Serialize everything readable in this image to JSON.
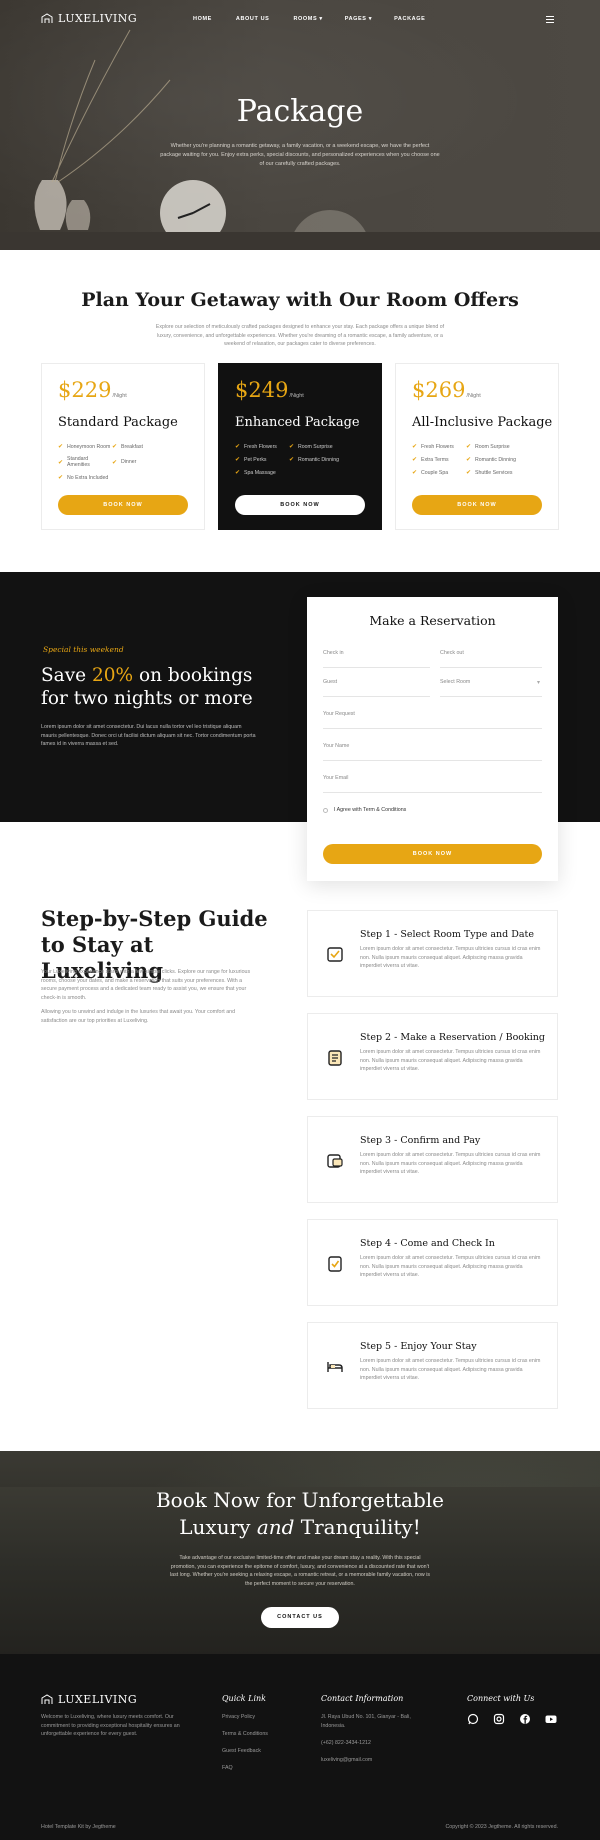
{
  "brand": {
    "name": "LUXELIVING",
    "logo_icon": "house-logo-icon"
  },
  "nav": {
    "items": [
      "HOME",
      "ABOUT US",
      "ROOMS ▾",
      "PAGES ▾",
      "PACKAGE"
    ],
    "menu_icon": "hamburger-menu-icon"
  },
  "hero": {
    "title": "Package",
    "text": "Whether you're planning a romantic getaway, a family vacation, or a weekend escape, we have the perfect package waiting for you. Enjoy extra perks, special discounts, and personalized experiences when you choose one of our carefully crafted packages."
  },
  "offers": {
    "title": "Plan Your Getaway with Our Room Offers",
    "text": "Explore our selection of meticulously crafted packages designed to enhance your stay. Each package offers a unique blend of luxury, convenience, and unforgettable experiences. Whether you're dreaming of a romantic escape, a family adventure, or a weekend of relaxation, our packages cater to diverse preferences.",
    "cards": [
      {
        "price": "$229",
        "unit": "/Night",
        "name": "Standard Package",
        "features": [
          "Honeymoon Room",
          "Breakfast",
          "Standard Amenities",
          "Dinner",
          "No Extra Included"
        ],
        "button": "BOOK NOW"
      },
      {
        "price": "$249",
        "unit": "/Night",
        "name": "Enhanced Package",
        "features": [
          "Fresh Flowers",
          "Room Surprise",
          "Pet Perks",
          "Romantic Dinning",
          "Spa Massage"
        ],
        "button": "BOOK NOW"
      },
      {
        "price": "$269",
        "unit": "/Night",
        "name": "All-Inclusive Package",
        "features": [
          "Fresh Flowers",
          "Room Surprise",
          "Extra Terms",
          "Romantic Dinning",
          "Couple Spa",
          "Shuttle Services"
        ],
        "button": "BOOK NOW"
      }
    ]
  },
  "special": {
    "tag": "Special this weekend",
    "heading_pre": "Save ",
    "heading_highlight": "20%",
    "heading_post": " on bookings for two nights or more",
    "text": "Lorem ipsum dolor sit amet consectetur. Dui lacus nulla tortor vel leo tristique aliquam mauris pellentesque. Donec orci ut facilisi dictum aliquam sit nec. Tortor condimentum porta fames id in viverra massa et sed."
  },
  "reservation": {
    "title": "Make a Reservation",
    "check_in": "Check in",
    "check_out": "Check out",
    "guest": "Guest",
    "select_room": "Select Room",
    "request": "Your Request",
    "name": "Your Name",
    "email": "Your Email",
    "agree": "I Agree with Term & Conditions",
    "button": "BOOK NOW"
  },
  "guide": {
    "title": "Step-by-Step Guide to Stay at Luxeliving",
    "text1": "Your Luxeliving experience starts with a few simple clicks. Explore our range for luxurious rooms, choose your dates, and make a reservation that suits your preferences. With a secure payment process and a dedicated team ready to assist you, we ensure that your check-in is smooth.",
    "text2": "Allowing you to unwind and indulge in the luxuries that await you. Your comfort and satisfaction are our top priorities at Luxeliving.",
    "steps": [
      {
        "title": "Step 1 - Select Room Type and Date",
        "icon": "calendar-check-icon",
        "text": "Lorem ipsum dolor sit amet consectetur. Tempus ultricies cursus id cras enim non. Nulla ipsum mauris consequat aliquet. Adipiscing massa gravida imperdiet viverra ut vitae."
      },
      {
        "title": "Step 2 - Make a Reservation / Booking",
        "icon": "clipboard-list-icon",
        "text": "Lorem ipsum dolor sit amet consectetur. Tempus ultricies cursus id cras enim non. Nulla ipsum mauris consequat aliquet. Adipiscing massa gravida imperdiet viverra ut vitae."
      },
      {
        "title": "Step 3 - Confirm and Pay",
        "icon": "payment-card-icon",
        "text": "Lorem ipsum dolor sit amet consectetur. Tempus ultricies cursus id cras enim non. Nulla ipsum mauris consequat aliquet. Adipiscing massa gravida imperdiet viverra ut vitae."
      },
      {
        "title": "Step 4 - Come and Check In",
        "icon": "clipboard-check-icon",
        "text": "Lorem ipsum dolor sit amet consectetur. Tempus ultricies cursus id cras enim non. Nulla ipsum mauris consequat aliquet. Adipiscing massa gravida imperdiet viverra ut vitae."
      },
      {
        "title": "Step 5 - Enjoy Your Stay",
        "icon": "bed-icon",
        "text": "Lorem ipsum dolor sit amet consectetur. Tempus ultricies cursus id cras enim non. Nulla ipsum mauris consequat aliquet. Adipiscing massa gravida imperdiet viverra ut vitae."
      }
    ]
  },
  "cta": {
    "line1": "Book Now for Unforgettable",
    "line2_pre": "Luxury ",
    "line2_italic": "and",
    "line2_post": " Tranquility!",
    "text": "Take advantage of our exclusive limited-time offer and make your dream stay a reality. With this special promotion, you can experience the epitome of comfort, luxury, and convenience at a discounted rate that won't last long. Whether you're seeking a relaxing escape, a romantic retreat, or a memorable family vacation, now is the perfect moment to secure your reservation.",
    "button": "CONTACT US"
  },
  "footer": {
    "about": "Welcome to Luxeliving, where luxury meets comfort. Our commitment to providing exceptional hospitality ensures an unforgettable experience for every guest.",
    "quick_link_title": "Quick Link",
    "quick_links": [
      "Privacy Policy",
      "Terms & Conditions",
      "Guest Feedback",
      "FAQ"
    ],
    "contact_title": "Contact Information",
    "address": "Jl. Raya Ubud No. 101, Gianyar - Bali, Indonesia.",
    "phone": "(+62) 822-3434-1212",
    "email": "luxeliving@gmail.com",
    "connect_title": "Connect with Us",
    "socials": [
      "whatsapp-icon",
      "instagram-icon",
      "facebook-icon",
      "youtube-icon"
    ],
    "bottom_left": "Hotel Template Kit by Jegtheme",
    "bottom_right": "Copyright © 2023 Jegtheme. All rights reserved."
  },
  "colors": {
    "accent": "#e7a614",
    "dark": "#121212"
  }
}
